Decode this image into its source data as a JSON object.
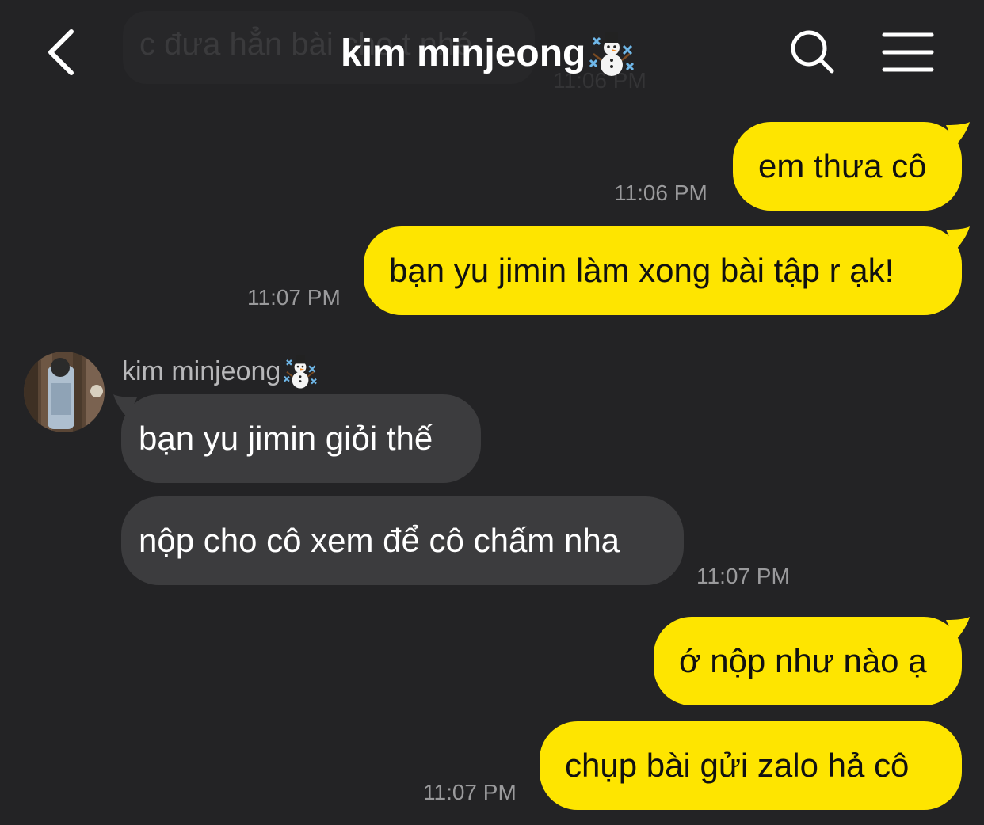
{
  "header": {
    "title": "kim minjeong",
    "title_emoji": "snowman-emoji",
    "back_icon": "chevron-left-icon",
    "search_icon": "search-icon",
    "menu_icon": "hamburger-menu-icon"
  },
  "ghost_message": {
    "text": "c đưa hẳn bài cho t nhé",
    "time": "11:06 PM"
  },
  "messages": [
    {
      "direction": "out",
      "text": "em thưa cô",
      "time": "11:06 PM"
    },
    {
      "direction": "out",
      "text": "bạn yu jimin làm xong bài tập r ạk!",
      "time": "11:07 PM"
    },
    {
      "direction": "in",
      "sender": "kim minjeong",
      "text": "bạn yu jimin giỏi thế"
    },
    {
      "direction": "in",
      "text": "nộp cho cô xem để cô chấm nha",
      "time": "11:07 PM"
    },
    {
      "direction": "out",
      "text": "ớ nộp như nào ạ"
    },
    {
      "direction": "out",
      "text": "chụp bài gửi zalo hả cô",
      "time": "11:07 PM"
    }
  ],
  "colors": {
    "background": "#232325",
    "outgoing_bubble": "#fee500",
    "incoming_bubble": "#3c3c3e",
    "timestamp": "#9a9a9c"
  }
}
